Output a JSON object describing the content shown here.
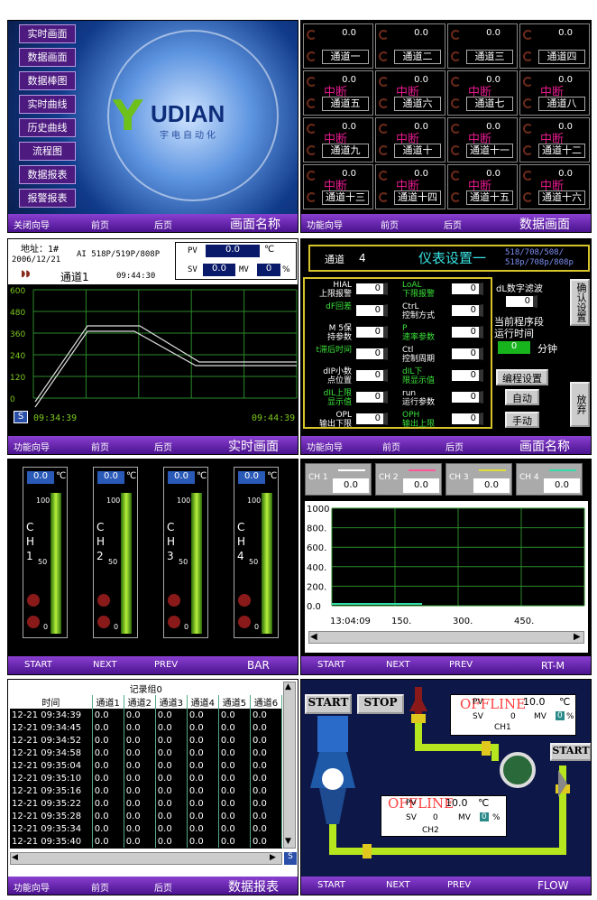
{
  "p1": {
    "menu": [
      "实时画面",
      "数据画面",
      "数据棒图",
      "实时曲线",
      "历史曲线",
      "流程图",
      "数据报表",
      "报警报表"
    ],
    "logo_text": "UDIAN",
    "logo_sub": "宇电自动化",
    "status": [
      "关闭向导",
      "前页",
      "后页",
      "画面名称"
    ]
  },
  "p2": {
    "cells": [
      {
        "v": "0.0",
        "name": "通道一",
        "broken": false
      },
      {
        "v": "0.0",
        "name": "通道二",
        "broken": false
      },
      {
        "v": "0.0",
        "name": "通道三",
        "broken": false
      },
      {
        "v": "0.0",
        "name": "通道四",
        "broken": false
      },
      {
        "v": "0.0",
        "name": "通道五",
        "broken": true
      },
      {
        "v": "0.0",
        "name": "通道六",
        "broken": true
      },
      {
        "v": "0.0",
        "name": "通道七",
        "broken": true
      },
      {
        "v": "0.0",
        "name": "通道八",
        "broken": true
      },
      {
        "v": "0.0",
        "name": "通道九",
        "broken": true
      },
      {
        "v": "0.0",
        "name": "通道十",
        "broken": true
      },
      {
        "v": "0.0",
        "name": "通道十一",
        "broken": true
      },
      {
        "v": "0.0",
        "name": "通道十二",
        "broken": true
      },
      {
        "v": "0.0",
        "name": "通道十三",
        "broken": true
      },
      {
        "v": "0.0",
        "name": "通道十四",
        "broken": true
      },
      {
        "v": "0.0",
        "name": "通道十五",
        "broken": true
      },
      {
        "v": "0.0",
        "name": "通道十六",
        "broken": true
      }
    ],
    "broken_label": "中断",
    "status": [
      "功能向导",
      "前页",
      "后页",
      "数据画面"
    ]
  },
  "p3": {
    "addr": "地址：1#",
    "model": "AI 518P/519P/808P",
    "date": "2006/12/21",
    "channel": "通道1",
    "time": "09:44:30",
    "pv_label": "PV",
    "pv": "0.0",
    "unit": "℃",
    "sv_label": "SV",
    "sv": "0.0",
    "mv_label": "MV",
    "mv": "0",
    "pct": "%",
    "yticks": [
      "600",
      "480",
      "360",
      "240",
      "120",
      "0"
    ],
    "t_start": "09:34:39",
    "t_end": "09:44:39",
    "status": [
      "功能向导",
      "前页",
      "后页",
      "实时画面"
    ]
  },
  "p4": {
    "ch_label": "通道",
    "ch": "4",
    "title": "仪表设置一",
    "models": "518/708/508/\n518p/708p/808p",
    "left": [
      [
        "HIAL",
        "上限报警"
      ],
      [
        "dF回差"
      ],
      [
        "M 5保",
        "持参数"
      ],
      [
        "t滞后时间"
      ],
      [
        "dIP小数",
        "点位置"
      ],
      [
        "dIL上限",
        "显示值"
      ],
      [
        "OPL",
        "输出下限"
      ]
    ],
    "mid": [
      [
        "LoAL",
        "下限报警"
      ],
      [
        "CtrL",
        "控制方式"
      ],
      [
        "P",
        "速率参数"
      ],
      [
        "Ctl",
        "控制周期"
      ],
      [
        "dIL下",
        "限显示值"
      ],
      [
        "run",
        "运行参数"
      ],
      [
        "OPH",
        "输出上限"
      ]
    ],
    "vals": "0",
    "filter": "dL数字滤波",
    "prog": "当前程序段",
    "runtime": "运行时间",
    "minute": "分钟",
    "progval": "0",
    "confirm": "确认设置",
    "release": "放弃",
    "btn_edit": "编程设置",
    "btn_auto": "自动",
    "btn_manual": "手动",
    "status": [
      "功能向导",
      "前页",
      "后页",
      "画面名称"
    ]
  },
  "p5": {
    "bars": [
      {
        "v": "0.0",
        "ch": "CH1"
      },
      {
        "v": "0.0",
        "ch": "CH2"
      },
      {
        "v": "0.0",
        "ch": "CH3"
      },
      {
        "v": "0.0",
        "ch": "CH4"
      }
    ],
    "unit": "℃",
    "top": "100",
    "mid": "50",
    "bot": "0",
    "status": [
      "START",
      "NEXT",
      "PREV",
      "BAR"
    ]
  },
  "p6": {
    "chs": [
      {
        "n": "CH 1",
        "v": "0.0",
        "c": "#ffffff"
      },
      {
        "n": "CH 2",
        "v": "0.0",
        "c": "#ff5599"
      },
      {
        "n": "CH 3",
        "v": "0.0",
        "c": "#dddd33"
      },
      {
        "n": "CH 4",
        "v": "0.0",
        "c": "#33ddaa"
      }
    ],
    "yticks": [
      "1000",
      "800.",
      "600.",
      "400.",
      "200.",
      "0.0"
    ],
    "xticks": [
      "13:04:09",
      "150.",
      "300.",
      "450."
    ],
    "status": [
      "START",
      "NEXT",
      "PREV",
      "RT-M"
    ]
  },
  "p7": {
    "title": "记录组0",
    "headers": [
      "时间",
      "通道1",
      "通道2",
      "通道3",
      "通道4",
      "通道5",
      "通道6"
    ],
    "rows": [
      [
        "12-21 09:34:39",
        "0.0",
        "0.0",
        "0.0",
        "0.0",
        "0.0",
        "0.0"
      ],
      [
        "12-21 09:34:45",
        "0.0",
        "0.0",
        "0.0",
        "0.0",
        "0.0",
        "0.0"
      ],
      [
        "12-21 09:34:52",
        "0.0",
        "0.0",
        "0.0",
        "0.0",
        "0.0",
        "0.0"
      ],
      [
        "12-21 09:34:58",
        "0.0",
        "0.0",
        "0.0",
        "0.0",
        "0.0",
        "0.0"
      ],
      [
        "12-21 09:35:04",
        "0.0",
        "0.0",
        "0.0",
        "0.0",
        "0.0",
        "0.0"
      ],
      [
        "12-21 09:35:10",
        "0.0",
        "0.0",
        "0.0",
        "0.0",
        "0.0",
        "0.0"
      ],
      [
        "12-21 09:35:16",
        "0.0",
        "0.0",
        "0.0",
        "0.0",
        "0.0",
        "0.0"
      ],
      [
        "12-21 09:35:22",
        "0.0",
        "0.0",
        "0.0",
        "0.0",
        "0.0",
        "0.0"
      ],
      [
        "12-21 09:35:28",
        "0.0",
        "0.0",
        "0.0",
        "0.0",
        "0.0",
        "0.0"
      ],
      [
        "12-21 09:35:34",
        "0.0",
        "0.0",
        "0.0",
        "0.0",
        "0.0",
        "0.0"
      ],
      [
        "12-21 09:35:40",
        "0.0",
        "0.0",
        "0.0",
        "0.0",
        "0.0",
        "0.0"
      ]
    ],
    "status": [
      "功能向导",
      "前页",
      "后页",
      "数据报表"
    ]
  },
  "p8": {
    "start": "START",
    "stop": "STOP",
    "start2": "START",
    "offline": "OFFLINE",
    "pv_label": "PV",
    "pv1": "10.0",
    "sv_label": "SV",
    "sv": "0",
    "mv_label": "MV",
    "mv": "0",
    "pct": "%",
    "unit": "℃",
    "ch1": "CH1",
    "ch2": "CH2",
    "pv2": "10.0",
    "status": [
      "START",
      "NEXT",
      "PREV",
      "FLOW"
    ]
  }
}
